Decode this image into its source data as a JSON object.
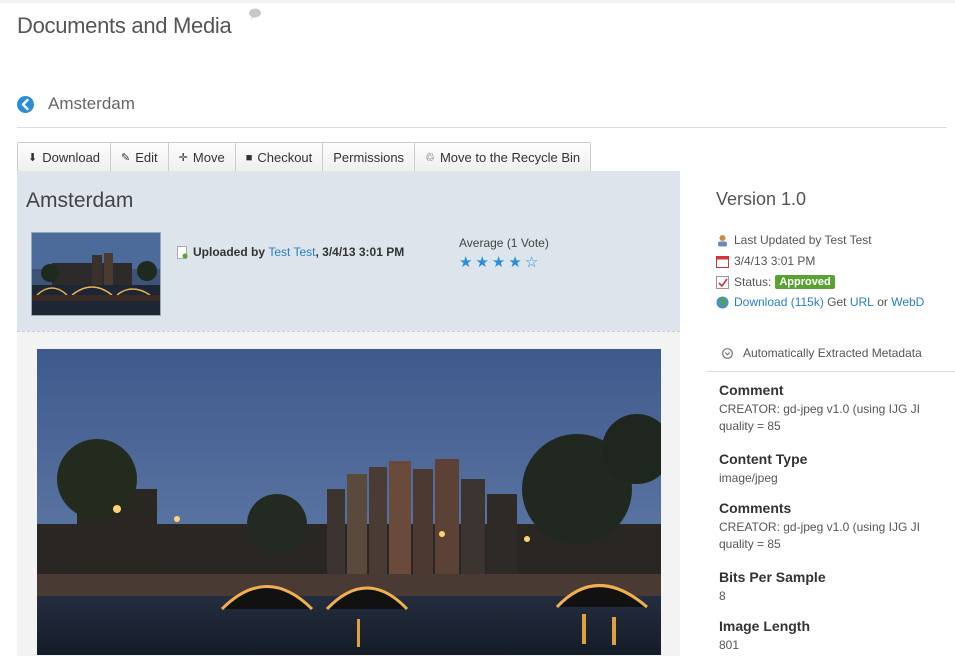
{
  "app": {
    "title": "Documents and Media",
    "folder": "Amsterdam"
  },
  "toolbar": {
    "download": "Download",
    "edit": "Edit",
    "move": "Move",
    "checkout": "Checkout",
    "permissions": "Permissions",
    "recycle": "Move to the Recycle Bin"
  },
  "document": {
    "title": "Amsterdam",
    "uploaded_prefix": "Uploaded by ",
    "uploader": "Test Test",
    "uploaded_date": ", 3/4/13 3:01 PM",
    "rating_label": "Average (1 Vote)",
    "rating_value": 4,
    "rating_max": 5
  },
  "sidebar": {
    "version": "Version 1.0",
    "last_updated": "Last Updated by Test Test",
    "date": "3/4/13 3:01 PM",
    "status_label": "Status:",
    "status_value": "Approved",
    "download_link": "Download (115k)",
    "get_text": " Get ",
    "url_link": "URL",
    "or_text": " or ",
    "webdav_link": "WebD",
    "auto_metadata": "Automatically Extracted Metadata",
    "metadata": [
      {
        "label": "Comment",
        "value": "CREATOR: gd-jpeg v1.0 (using IJG JI quality = 85"
      },
      {
        "label": "Content Type",
        "value": "image/jpeg"
      },
      {
        "label": "Comments",
        "value": "CREATOR: gd-jpeg v1.0 (using IJG JI quality = 85"
      },
      {
        "label": "Bits Per Sample",
        "value": "8"
      },
      {
        "label": "Image Length",
        "value": "801"
      }
    ]
  },
  "colors": {
    "accent": "#2a7ec8",
    "approved": "#5aa233",
    "panel": "#dde4ec"
  }
}
